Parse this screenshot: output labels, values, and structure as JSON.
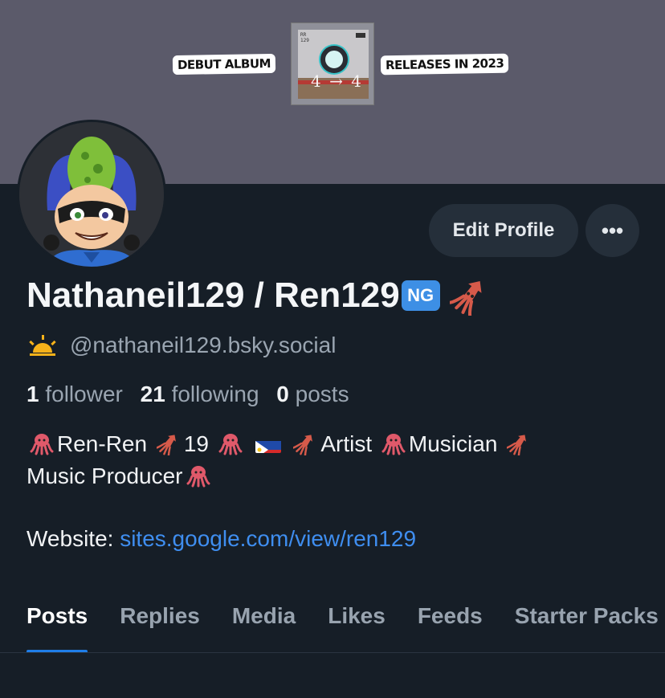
{
  "banner": {
    "left_label": "DEBUT ALBUM",
    "right_label": "RELEASES IN 2023",
    "cover_text": "4 → 4"
  },
  "actions": {
    "edit_label": "Edit Profile",
    "more_label": "•••"
  },
  "profile": {
    "display_name": "Nathaneil129 / Ren129",
    "badge_text": "NG",
    "handle": "@nathaneil129.bsky.social",
    "followers_count": "1",
    "followers_label": "follower",
    "following_count": "21",
    "following_label": "following",
    "posts_count": "0",
    "posts_label": "posts",
    "bio_line1_a": "Ren-Ren",
    "bio_line1_b": "19",
    "bio_line1_c": "Artist",
    "bio_line1_d": "Musician",
    "bio_line2": "Music Producer",
    "website_label": "Website:",
    "website_link": "sites.google.com/view/ren129"
  },
  "tabs": [
    "Posts",
    "Replies",
    "Media",
    "Likes",
    "Feeds",
    "Starter Packs"
  ],
  "colors": {
    "background": "#161e27",
    "banner": "#5b5a6a",
    "accent": "#1f7ee8",
    "link": "#3f8ef0",
    "muted_text": "#9aa5b1",
    "button_bg": "#252f3a"
  },
  "icons": {
    "more": "more-horizontal-icon",
    "squid": "squid-emoji-icon",
    "octopus": "octopus-emoji-icon",
    "sunrise": "sunrise-emoji-icon",
    "flag": "philippines-flag-icon"
  }
}
